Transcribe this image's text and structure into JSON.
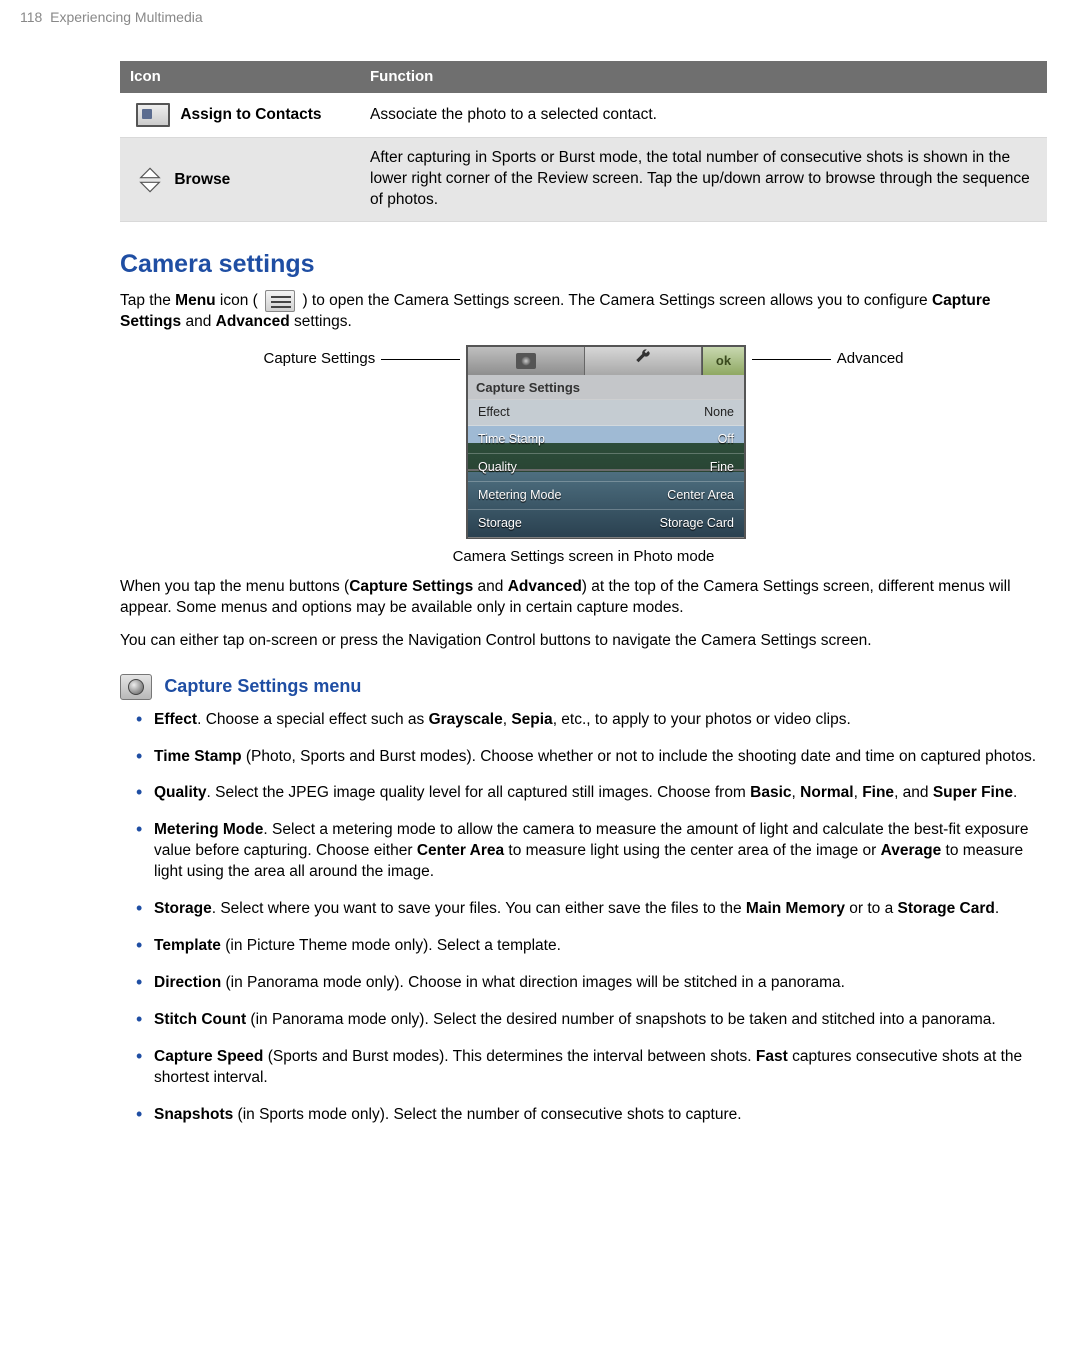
{
  "header": {
    "pageNumber": "118",
    "chapter": "Experiencing Multimedia"
  },
  "table": {
    "headers": {
      "icon": "Icon",
      "function": "Function"
    },
    "rows": [
      {
        "iconLabel": "Assign to Contacts",
        "func": "Associate the photo to a selected contact."
      },
      {
        "iconLabel": "Browse",
        "func": "After capturing in Sports or Burst mode, the total number of consecutive shots is shown in the lower right corner of the Review screen. Tap the up/down arrow to browse through the sequence of photos."
      }
    ]
  },
  "sectionTitle": "Camera settings",
  "intro": {
    "p1a": "Tap the ",
    "p1b": "Menu",
    "p1c": " icon ( ",
    "p1d": " ) to open the Camera Settings screen. The Camera Settings screen allows you to configure ",
    "p1e": "Capture Settings",
    "p1f": " and ",
    "p1g": "Advanced",
    "p1h": " settings."
  },
  "figure": {
    "leftLabel": "Capture Settings",
    "rightLabel": "Advanced",
    "okLabel": "ok",
    "bannerTitle": "Capture Settings",
    "rows": [
      {
        "label": "Effect",
        "value": "None"
      },
      {
        "label": "Time Stamp",
        "value": "Off"
      },
      {
        "label": "Quality",
        "value": "Fine"
      },
      {
        "label": "Metering Mode",
        "value": "Center Area"
      },
      {
        "label": "Storage",
        "value": "Storage Card"
      }
    ],
    "caption": "Camera Settings screen in Photo mode"
  },
  "afterFig": {
    "p1a": "When you tap the menu buttons (",
    "p1b": "Capture Settings",
    "p1c": " and ",
    "p1d": "Advanced",
    "p1e": ") at the top of the Camera Settings screen, different menus will appear. Some menus and options may be available only in certain capture modes.",
    "p2": "You can either tap on-screen or press the Navigation Control buttons to navigate the Camera Settings screen."
  },
  "subsectionTitle": "Capture Settings menu",
  "bullets": {
    "b1": {
      "t1": "Effect",
      "t2": ". Choose a special effect such as ",
      "t3": "Grayscale",
      "t4": ", ",
      "t5": "Sepia",
      "t6": ", etc., to apply to your photos or video clips."
    },
    "b2": {
      "t1": "Time Stamp",
      "t2": " (Photo, Sports and Burst modes). Choose whether or not to include the shooting date and time on captured photos."
    },
    "b3": {
      "t1": "Quality",
      "t2": ". Select the JPEG image quality level for all captured still images. Choose from ",
      "t3": "Basic",
      "t4": ", ",
      "t5": "Normal",
      "t6": ", ",
      "t7": "Fine",
      "t8": ", and ",
      "t9": "Super Fine",
      "t10": "."
    },
    "b4": {
      "t1": "Metering Mode",
      "t2": ". Select a metering mode to allow the camera to measure the amount of light and calculate the best-fit exposure value before capturing. Choose either ",
      "t3": "Center Area",
      "t4": " to measure light using the center area of the image or ",
      "t5": "Average",
      "t6": " to measure light using the area all around the image."
    },
    "b5": {
      "t1": "Storage",
      "t2": ". Select where you want to save your files. You can either save the files to the ",
      "t3": "Main Memory",
      "t4": " or to a ",
      "t5": "Storage Card",
      "t6": "."
    },
    "b6": {
      "t1": "Template",
      "t2": " (in Picture Theme mode only). Select a template."
    },
    "b7": {
      "t1": "Direction",
      "t2": " (in Panorama mode only). Choose in what direction images will be stitched in a panorama."
    },
    "b8": {
      "t1": "Stitch Count",
      "t2": " (in Panorama mode only). Select the desired number of snapshots to be taken and stitched into a panorama."
    },
    "b9": {
      "t1": "Capture Speed",
      "t2": " (Sports and Burst modes). This determines the interval between shots. ",
      "t3": "Fast",
      "t4": " captures consecutive shots at the shortest interval."
    },
    "b10": {
      "t1": "Snapshots",
      "t2": " (in Sports mode only). Select the number of consecutive shots to capture."
    }
  }
}
